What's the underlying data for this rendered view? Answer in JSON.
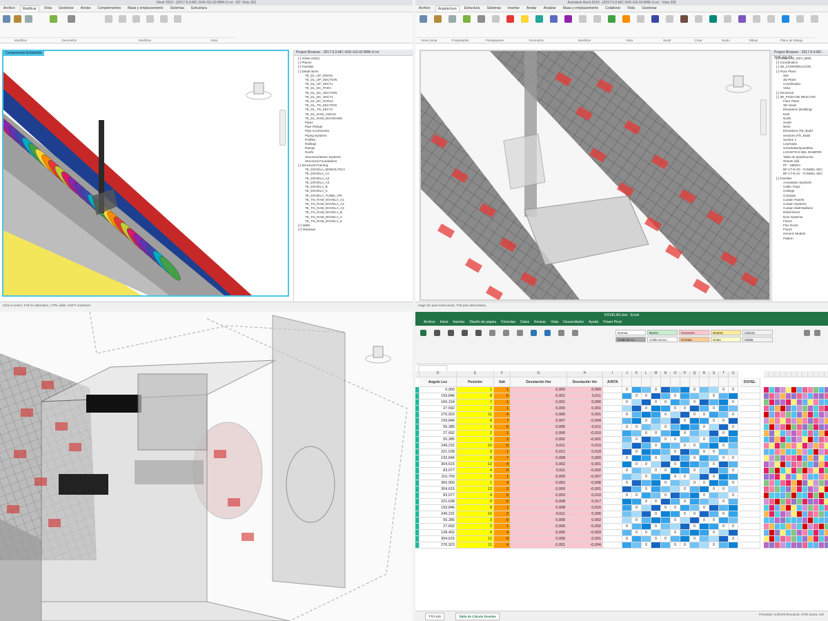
{
  "q1": {
    "title": "Revit 2019 - [2017-5.0-MC-SVK-GS-02-BRK-0.rvt - 3D: Vista 3D]",
    "tabs": [
      "Archivo",
      "Modificar",
      "Vista",
      "Gestionar",
      "Anotar",
      "Complementos",
      "Masa y emplazamiento",
      "Sistemas",
      "Estructura"
    ],
    "viewport_title": "Componente Embebido",
    "browser_title": "Project Browser - 2017-5.0-MC-SVK-GS-02-BRK-0.rvt",
    "tree": [
      "[-] Vistas (todo)",
      "[-] Planos",
      "[-] Familias",
      "[-] Detail Items",
      "TE_DL_UP_DWGS",
      "TE_DL_UP_SECTION",
      "TE_DL_UP_SECT1",
      "TE_DL_DC_PARA",
      "TE_DL_DC_SECTION",
      "TE_DL_DC_SECT1",
      "TE_DL_DC_PARA2",
      "TE_DL_TN_SECTION",
      "TE_DL_TN_SECT1",
      "TE_DL_RAM_ANGLE",
      "TE_DL_RAM_DIAGRAMS",
      "Pipes",
      "Pipe Fittings",
      "Pipe Accessories",
      "Piping Systems",
      "Profiles",
      "Railings",
      "Ramps",
      "Roofs",
      "Structural Beam Systems",
      "Structural Foundations",
      "[-] Structural Framing",
      "TE_DOVELA_MONOLITICA",
      "TE_DOVELA_A1",
      "TE_DOVELA_A2",
      "TE_DOVELA_A3",
      "TE_DOVELA_B",
      "TE_DOVELA_C",
      "TE_DOVELA_TUNEL_PR",
      "TE_TN_RAM_DOVELA_A1",
      "TE_TN_RAM_DOVELA_A2",
      "TE_TN_RAM_DOVELA_A3",
      "TE_TN_RAM_DOVELA_B",
      "TE_TN_RAM_DOVELA_C",
      "TE_TN_RAM_DOVELA_K",
      "[+] Walls",
      "[+] Windows"
    ],
    "status": "Click to select, TAB for alternates, CTRL adds, SHIFT unselects.",
    "groups": [
      "Modificar",
      "Geometría",
      "Modificar",
      "Vista"
    ]
  },
  "q2": {
    "title": "Autodesk Revit 2019 - [2017-5.0-MC-SVK-GS-02-BRK-0.rvt - Vista 3D]",
    "tabs": [
      "Archivo",
      "Arquitectura",
      "Estructura",
      "Sistemas",
      "Insertar",
      "Anotar",
      "Analizar",
      "Masa y emplazamiento",
      "Colaborar",
      "Vista",
      "Gestionar"
    ],
    "browser_title": "Project Browser - 2017-5.0-MC-SVK-GS-02",
    "tree": [
      "[-] Vistas (TE_DEV_BIM)",
      "[-] Coordination",
      "[-] 3D_COORDINACION",
      "[-] Floor Plans",
      "Site",
      "3D Plans",
      "Coordinador",
      "Vista",
      "[-] Structural",
      "[-] 3D_POZO DE RESCATE",
      "Floor Plans",
      "3D Views",
      "Elevations (Building)",
      "East",
      "North",
      "South",
      "West",
      "Elevations (TE_Build",
      "Sections (TE_Build",
      "Section 1",
      "Leyendas",
      "Schedules/Quantities",
      "LOGISTICS DEL DUMPER",
      "Tabla de planificacion",
      "Sheets (all)",
      "PF - MEDIO",
      "BF-CT-E-00 - TUNNEL SEC",
      "BF-CT-E-01 - TUNNEL SEC",
      "[-] Families",
      "Annotation Symbols",
      "Cable Trays",
      "Ceilings",
      "Conduits",
      "Curtain Panels",
      "Curtain Systems",
      "Curtain Wall Mullions",
      "Detail Items",
      "Duct Systems",
      "Floors",
      "Flex Ducts",
      "Floors",
      "Generic Models",
      "Pattern"
    ],
    "groups": [
      "Seleccionar",
      "Propiedades",
      "Portapapeles",
      "Geometría",
      "Modificar",
      "Vista",
      "Medir",
      "Crear",
      "Modo",
      "Dibujo",
      "Plano de trabajo"
    ],
    "status": "Haga clic para seleccionar, TAB para alternativas"
  },
  "q3": {
    "label": "Vista 3D - Nicho de seguridad"
  },
  "q4": {
    "title": "DOVELAS.xlsx - Excel",
    "tabs": [
      "Archivo",
      "Inicio",
      "Insertar",
      "Diseño de página",
      "Fórmulas",
      "Datos",
      "Revisar",
      "Vista",
      "Desarrollador",
      "Ayuda",
      "Power Pivot"
    ],
    "styles": [
      {
        "label": "Normal",
        "color": "#ffffff"
      },
      {
        "label": "Bueno",
        "color": "#c6efce"
      },
      {
        "label": "Incorrecto",
        "color": "#ffc7ce"
      },
      {
        "label": "Neutral",
        "color": "#ffeb9c"
      },
      {
        "label": "Cálculo",
        "color": "#f2f2f2"
      },
      {
        "label": "Celda de co...",
        "color": "#a5a5a5"
      },
      {
        "label": "Celda vincul...",
        "color": "#ffffff"
      },
      {
        "label": "Entrada",
        "color": "#ffcc99"
      },
      {
        "label": "Notas",
        "color": "#ffffcc"
      },
      {
        "label": "Salida",
        "color": "#f2f2f2"
      }
    ],
    "col_letters": [
      "D",
      "E",
      "F",
      "G",
      "H",
      "I",
      "J",
      "K",
      "L",
      "M",
      "N",
      "O",
      "P",
      "Q",
      "R",
      "S",
      "T",
      "U",
      "V",
      "W",
      "X",
      "Y",
      "Z"
    ],
    "headers": {
      "angulo": "Angulo Loc",
      "posicion": "Posición",
      "salto": "Salt",
      "desv_h": "Desviación Hor",
      "desv_v": "Desviación Ver",
      "junta": "JUNTA",
      "dovel": "DOVEL"
    },
    "row_start": 2,
    "rows": [
      [
        "0,000",
        "1",
        "1",
        "0,000",
        "0,000"
      ],
      [
        "193,846",
        "8",
        "6",
        "0,001",
        "0,011"
      ],
      [
        "166,154",
        "7",
        "1",
        "0,001",
        "0,006"
      ],
      [
        "27,692",
        "2",
        "1",
        "0,000",
        "0,001"
      ],
      [
        "276,923",
        "11",
        "4",
        "0,000",
        "0,001"
      ],
      [
        "193,846",
        "8",
        "7",
        "0,007",
        "-0,004"
      ],
      [
        "55,385",
        "3",
        "6",
        "0,006",
        "-0,011"
      ],
      [
        "27,692",
        "2",
        "1",
        "0,006",
        "-0,010"
      ],
      [
        "55,385",
        "3",
        "3",
        "0,002",
        "-0,001"
      ],
      [
        "249,231",
        "10",
        "6",
        "0,011",
        "0,010"
      ],
      [
        "221,538",
        "9",
        "1",
        "0,012",
        "0,018"
      ],
      [
        "193,846",
        "8",
        "7",
        "0,008",
        "0,000"
      ],
      [
        "304,615",
        "12",
        "4",
        "0,002",
        "0,001"
      ],
      [
        "83,077",
        "4",
        "8",
        "0,011",
        "-0,002"
      ],
      [
        "110,769",
        "5",
        "1",
        "0,009",
        "-0,007"
      ],
      [
        "360,000",
        "1",
        "4",
        "0,002",
        "-0,008"
      ],
      [
        "304,615",
        "12",
        "2",
        "0,000",
        "-0,001"
      ],
      [
        "83,077",
        "4",
        "6",
        "0,003",
        "0,010"
      ],
      [
        "221,538",
        "9",
        "5",
        "0,008",
        "0,017"
      ],
      [
        "193,846",
        "8",
        "1",
        "0,008",
        "0,015"
      ],
      [
        "249,231",
        "10",
        "2",
        "0,011",
        "0,006"
      ],
      [
        "55,385",
        "3",
        "6",
        "0,006",
        "0,002"
      ],
      [
        "27,692",
        "2",
        "1",
        "0,006",
        "-0,002"
      ],
      [
        "138,462",
        "6",
        "4",
        "0,006",
        "-0,003"
      ],
      [
        "304,615",
        "12",
        "6",
        "0,006",
        "0,001"
      ],
      [
        "276,923",
        "11",
        "4",
        "0,001",
        "-0,004"
      ]
    ],
    "sheets": [
      "TTO-100",
      "Tabla de Cálculo Dovelas"
    ],
    "cell_zero": "0",
    "status": "Promedio: 0,00478  Recuento: 2700  Suma: 130"
  },
  "colors": {
    "revit_select": "#4cc3e6",
    "excel_green": "#217346",
    "yellow_col": "#ffff00",
    "orange_col": "#ff9a00",
    "pink_col": "#f8c6cf",
    "teal_col": "#1abc9c"
  }
}
